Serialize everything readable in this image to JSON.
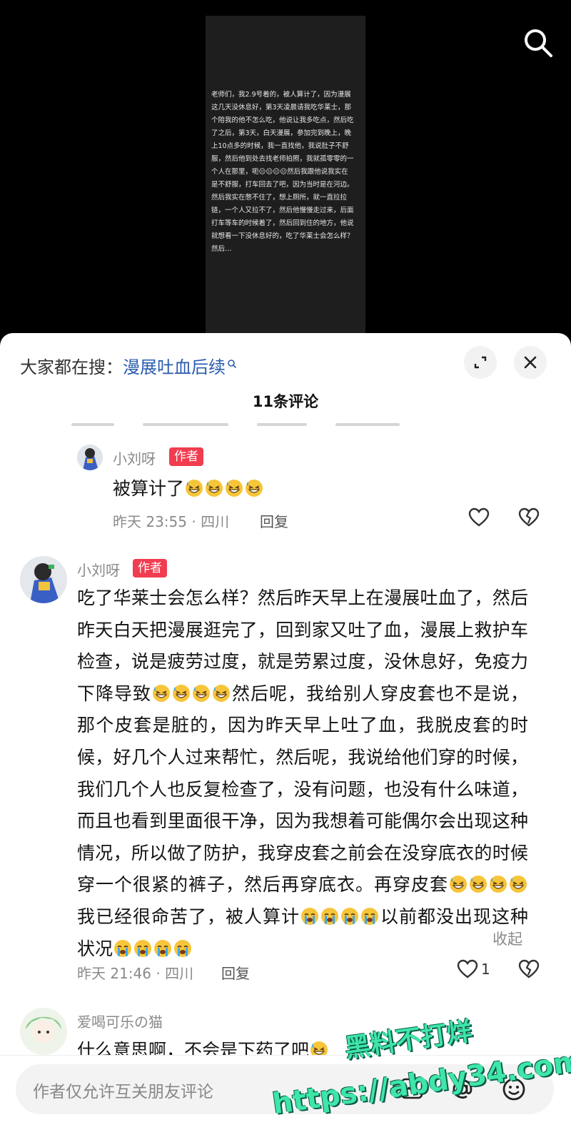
{
  "video": {
    "overlay_text": "老师们，我2.9号着的，被人算计了，因为漫展这几天没休息好，第3天凌晨请我吃华莱士，那个陪我的他不怎么吃，他说让我多吃点，然后吃了之后，第3天，白天漫展，参加完到晚上，晚上10点多的时候，我一直找他，我说肚子不舒服，然后他到处去找老师拍照，我就孤零零的一个人在那里，呃😐😐😐😐然后我跟他说我实在是不舒服，打车回去了吧，因为当时是在河边。然后我实在憋不住了，想上厕所，就一直拉拉链，一个人又拉不了，然后他慢慢走过来，后面打车等车的时候着了，然后回到住的地方，他说就想看一下没休息好的，吃了华莱士会怎么样？然后…"
  },
  "sheet": {
    "search_prefix": "大家都在搜：",
    "search_term": "漫展吐血后续",
    "comment_count": "11条评论"
  },
  "comments": [
    {
      "username": "小刘呀",
      "badge": "作者",
      "text": "被算计了",
      "emoji_count": 4,
      "time_location": "昨天 23:55 · 四川",
      "reply_label": "回复",
      "likes": ""
    },
    {
      "username": "小刘呀",
      "badge": "作者",
      "seg1": "吃了华莱士会怎么样？然后昨天早上在漫展吐血了，然后昨天白天把漫展逛完了，回到家又吐了血，漫展上救护车检查，说是疲劳过度，就是劳累过度，没休息好，免疫力下降导致",
      "seg2": "然后呢，我给别人穿皮套也不是说，那个皮套是脏的，因为昨天早上吐了血，我脱皮套的时候，好几个人过来帮忙，然后呢，我说给他们穿的时候，我们几个人也反复检查了，没有问题，也没有什么味道，而且也看到里面很干净，因为我想着可能偶尔会出现这种情况，所以做了防护，我穿皮套之前会在没穿底衣的时候穿一个很紧的裤子，然后再穿底衣。再穿皮套",
      "seg3": "我已经很命苦了，被人算计",
      "seg4": "以前都没出现这种状况",
      "collapse_label": "收起",
      "time_location": "昨天 21:46 · 四川",
      "reply_label": "回复",
      "likes": "1"
    },
    {
      "username": "爱喝可乐の猫",
      "text": "什么意思啊，不会是下药了吧"
    }
  ],
  "bottom": {
    "placeholder": "作者仅允许互关朋友评论"
  },
  "watermark": {
    "line1": "黑料不打烊",
    "line2": "https://abdy34.com"
  },
  "colors": {
    "badge": "#f13d4f",
    "link": "#2a5cad",
    "emoji_face": "#f7c53a",
    "tear": "#3aa8f0"
  }
}
